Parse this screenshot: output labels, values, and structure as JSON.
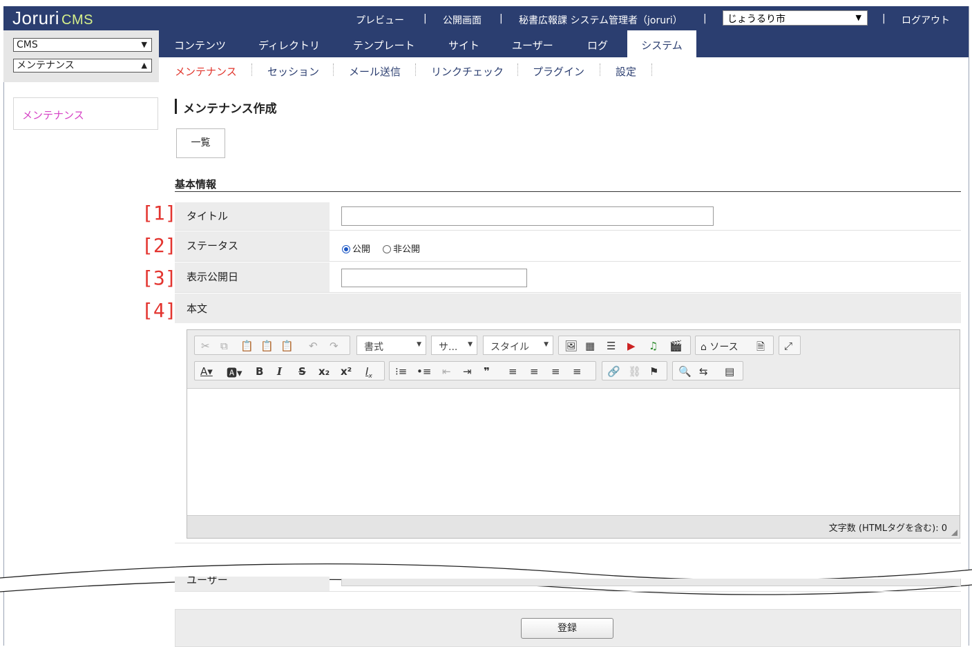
{
  "app": {
    "logo_main": "Joruri",
    "logo_sub": "CMS"
  },
  "topbar": {
    "preview": "プレビュー",
    "public_page": "公開画面",
    "user": "秘書広報課 システム管理者（joruri）",
    "site_select": "じょうるり市",
    "logout": "ログアウト",
    "separator": "|"
  },
  "left_selects": {
    "first": "CMS",
    "second": "メンテナンス"
  },
  "main_nav": [
    "コンテンツ",
    "ディレクトリ",
    "テンプレート",
    "サイト",
    "ユーザー",
    "ログ",
    "システム"
  ],
  "sub_nav": [
    "メンテナンス",
    "セッション",
    "メール送信",
    "リンクチェック",
    "プラグイン",
    "設定"
  ],
  "side_menu": {
    "item": "メンテナンス"
  },
  "page": {
    "title": "メンテナンス作成",
    "list_button": "一覧",
    "section": "基本情報"
  },
  "form": {
    "title_label": "タイトル",
    "status_label": "ステータス",
    "status_public": "公開",
    "status_private": "非公開",
    "date_label": "表示公開日",
    "body_label": "本文",
    "user_label": "ユーザー",
    "submit": "登録"
  },
  "markers": [
    "[1]",
    "[2]",
    "[3]",
    "[4]"
  ],
  "editor": {
    "format": "書式",
    "font": "サ...",
    "style": "スタイル",
    "source": "ソース",
    "char_count": "文字数 (HTMLタグを含む): 0"
  },
  "colors": {
    "nav_bg": "#2b3e70",
    "active_sub": "#e0342b",
    "side_link": "#d642c5",
    "marker": "#e3342f"
  }
}
